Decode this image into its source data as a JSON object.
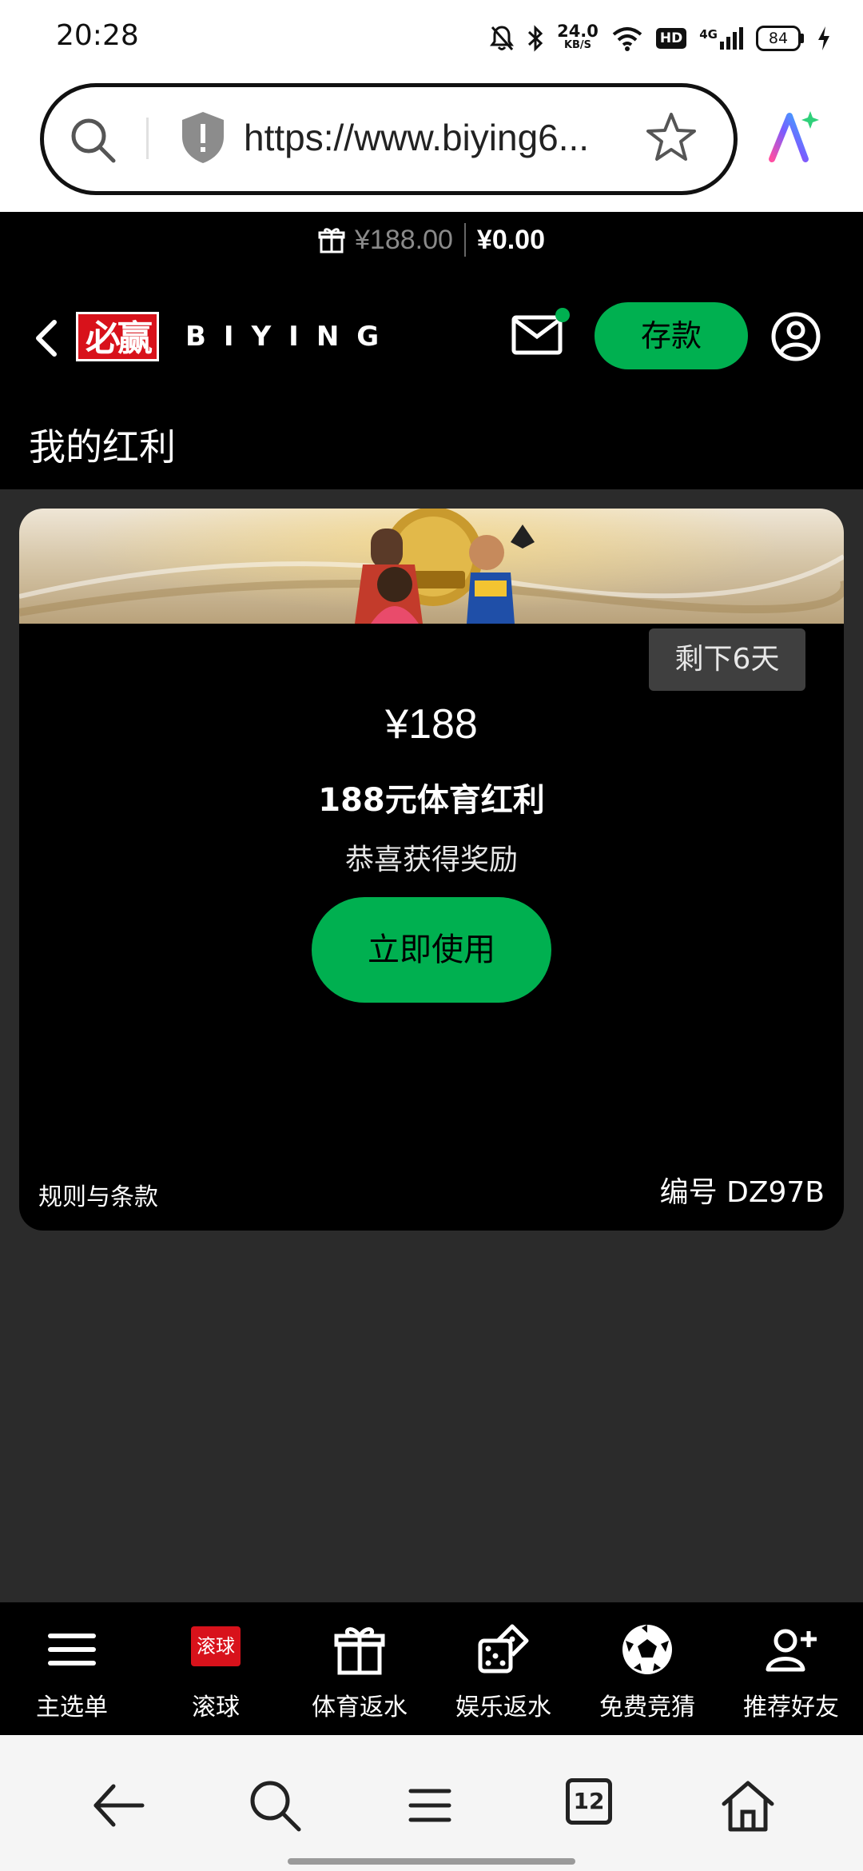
{
  "status_bar": {
    "time": "20:28",
    "speed_value": "24.0",
    "speed_unit": "KB/S",
    "hd": "HD",
    "network": "4G",
    "battery": "84"
  },
  "browser": {
    "url": "https://www.biying6...",
    "tab_count": "12"
  },
  "balance": {
    "bonus": "¥188.00",
    "cash": "¥0.00"
  },
  "header": {
    "logo_badge": "必赢",
    "logo_text": "BIYING",
    "deposit_label": "存款"
  },
  "page_title": "我的红利",
  "bonus_card": {
    "days_left": "剩下6天",
    "amount": "¥188",
    "name": "188元体育红利",
    "description": "恭喜获得奖励",
    "use_label": "立即使用",
    "terms_label": "规则与条款",
    "code": "编号 DZ97B"
  },
  "site_nav": {
    "items": [
      {
        "label": "主选单",
        "icon": "menu-icon"
      },
      {
        "label": "滚球",
        "icon": "live-badge",
        "badge": "滚球"
      },
      {
        "label": "体育返水",
        "icon": "gift-icon"
      },
      {
        "label": "娱乐返水",
        "icon": "dice-icon"
      },
      {
        "label": "免费竞猜",
        "icon": "soccer-ball-icon"
      },
      {
        "label": "推荐好友",
        "icon": "add-friend-icon"
      }
    ]
  },
  "colors": {
    "accent_green": "#00b050",
    "brand_red": "#d8121b",
    "page_bg": "#2b2b2b",
    "header_bg": "#000000"
  }
}
